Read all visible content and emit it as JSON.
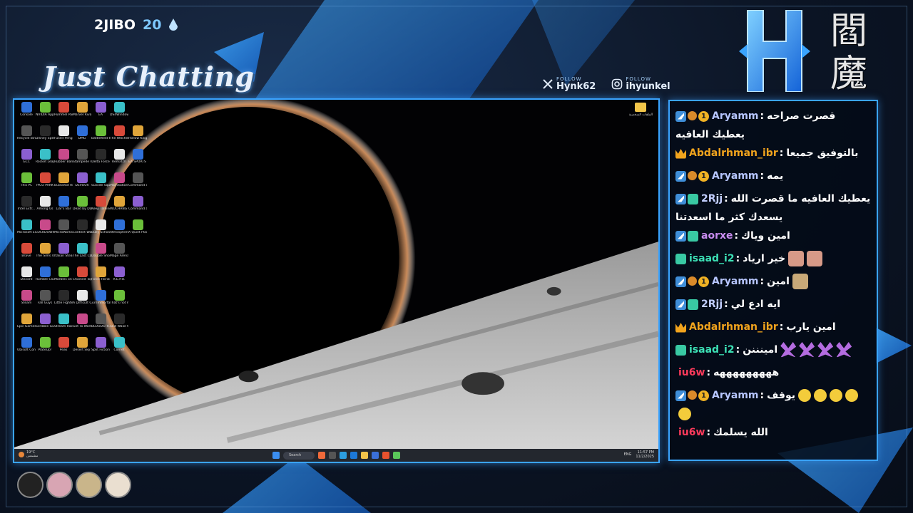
{
  "overlay": {
    "counter_name": "2JIBO",
    "counter_value": "20",
    "category": "Just Chatting",
    "socials": [
      {
        "label": "FOLLOW",
        "handle": "Hynk62",
        "icon": "x-logo-icon"
      },
      {
        "label": "FOLLOW",
        "handle": "ihyunkel",
        "icon": "instagram-icon"
      }
    ],
    "kanji": [
      "閻",
      "魔"
    ],
    "accent": "#3aa4ff"
  },
  "desktop": {
    "icons": [
      "Console",
      "NVIDIA App",
      "Pummel Party",
      "Marvel Rivals",
      "EA",
      "DS4Windows",
      "",
      "Recycle Bin",
      "Disney Speedstorm",
      "Fused Penguin",
      "DMG",
      "Battlefield 6",
      "The Witcher 3 Wild Hunt",
      "Hollow Knight",
      "GCC",
      "Rocket League",
      "Rubber Bandits",
      "Stampede Racing",
      "Delta Force",
      "Rematch",
      "EA SPORTS FC 25",
      "This PC",
      "PICO PARK",
      "Buckshot Roulette",
      "DEVOUR",
      "Suicide Squad Ki...",
      "PlayStation Accessories",
      "Command and Conqu...",
      "Intel Extr...",
      "Among Us",
      "Liar's Bar",
      "Dead by Daylight",
      "Keep Talking and Nobo...",
      "WUCHANG Fallen Fea...",
      "Command and Conqu...",
      "Microsoft Edge",
      "LOCKDOWN Protocol",
      "MicroWorks",
      "Content Warning",
      "Bully Scholarsh...",
      "Atmosphere 2",
      "A Quiet Place The Road A...",
      "Brave",
      "The Sims 4",
      "Italian Steam ch...",
      "The Last Campfire",
      "Double Shoulders",
      "Mage Arena",
      "",
      "Discord",
      "Rumble Club",
      "Marbles on Stream",
      "Chained Together",
      "Force Horizon 5",
      "R.E.P.O.",
      "",
      "Steam",
      "Fall Guys",
      "Little Fighters on Stream",
      "A Difficult Game Abo...",
      "33 Immortals",
      "That's not my Neighbor",
      "",
      "Epic Games Launcher",
      "Scribble Guys",
      "Stream Racer",
      "Get To Work",
      "BLOODSTR...",
      "Skill Wake the Beep",
      "",
      "Ubisoft Connect",
      "PlateUp!",
      "Peak",
      "Desert Sky Rides",
      "Split Fiction",
      "Cornet",
      ""
    ],
    "folder_label": "الملفات الشخصية",
    "taskbar": {
      "weather": "19°C",
      "weather_sub": "مشمس",
      "search": "Search",
      "lang": "ENG",
      "time": "11:57 PM",
      "date": "11/2/2025"
    }
  },
  "chat": {
    "messages": [
      {
        "badges": [
          "prime-badge",
          "hands-badge",
          "tier-badge"
        ],
        "user": "Aryamm",
        "color": "#b7c6ff",
        "text": "قصرت صراحه يعطيك العافيه",
        "emotes": []
      },
      {
        "badges": [
          "crown-badge"
        ],
        "user": "Abdalrhman_ibr",
        "color": "#f2a41d",
        "text": "بالتوفيق جميعا",
        "emotes": []
      },
      {
        "badges": [
          "prime-badge",
          "hands-badge",
          "tier-badge"
        ],
        "user": "Aryamm",
        "color": "#b7c6ff",
        "text": "يمه",
        "emotes": []
      },
      {
        "badges": [
          "prime-badge",
          "gift-badge"
        ],
        "user": "2Rjj",
        "color": "#c2cfff",
        "text": "يعطيك العافيه ما قصرت الله يسعدك كثر ما اسعدتنا",
        "emotes": []
      },
      {
        "badges": [
          "prime-badge",
          "gift-badge"
        ],
        "user": "aorxe",
        "color": "#c98cf0",
        "text": "امين وياك",
        "emotes": []
      },
      {
        "badges": [
          "gift-badge"
        ],
        "user": "isaad_i2",
        "color": "#3ce0b5",
        "text": "خير ارياد",
        "emotes": [
          "face",
          "face"
        ]
      },
      {
        "badges": [
          "prime-badge",
          "hands-badge",
          "tier-badge"
        ],
        "user": "Aryamm",
        "color": "#b7c6ff",
        "text": "امين",
        "emotes": [
          "dog"
        ]
      },
      {
        "badges": [
          "prime-badge",
          "gift-badge"
        ],
        "user": "2Rjj",
        "color": "#c2cfff",
        "text": "ايه ادع لي",
        "emotes": []
      },
      {
        "badges": [
          "crown-badge"
        ],
        "user": "Abdalrhman_ibr",
        "color": "#f2a41d",
        "text": "امين يارب",
        "emotes": []
      },
      {
        "badges": [
          "gift-badge"
        ],
        "user": "isaad_i2",
        "color": "#3ce0b5",
        "text": "امينننن",
        "emotes": [
          "purple",
          "purple",
          "purple",
          "purple"
        ]
      },
      {
        "badges": [],
        "user": "iu6w",
        "color": "#ff3b5c",
        "text": "هههههههههه",
        "emotes": []
      },
      {
        "badges": [
          "prime-badge",
          "hands-badge",
          "tier-badge"
        ],
        "user": "Aryamm",
        "color": "#b7c6ff",
        "text": "يوقف",
        "emotes": [
          "cry",
          "cry",
          "cry",
          "cry",
          "cry"
        ]
      },
      {
        "badges": [],
        "user": "iu6w",
        "color": "#ff3b5c",
        "text": "الله يسلمك",
        "emotes": []
      }
    ]
  },
  "bottom_avatars": [
    "avatar-1",
    "avatar-2",
    "avatar-3",
    "avatar-4"
  ]
}
